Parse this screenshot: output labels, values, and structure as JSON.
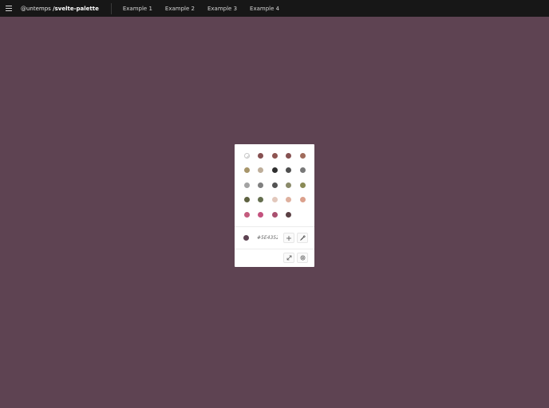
{
  "header": {
    "scope": "@untemps",
    "package": "/svelte-palette",
    "nav": [
      "Example 1",
      "Example 2",
      "Example 3",
      "Example 4"
    ]
  },
  "colors": {
    "background": "#5E4352",
    "topbar": "#171717"
  },
  "palette": {
    "swatches": [
      [
        "transparent",
        "#865051",
        "#8E5451",
        "#865151",
        "#A06B5B"
      ],
      [
        "#A7956A",
        "#BEAE9A",
        "#2F2F2F",
        "#4F4F4F",
        "#787878"
      ],
      [
        "#A3A3A3",
        "#7F7F7F",
        "#535353",
        "#8A8A6A",
        "#8A8A55"
      ],
      [
        "#5E6140",
        "#656F4F",
        "#E2C8BC",
        "#DEB09E",
        "#DBA08C"
      ],
      [
        "#C45C7E",
        "#C4527E",
        "#A9506F",
        "#5B4044"
      ]
    ],
    "current_color": "#5E4352",
    "hex_value": "#5E4352",
    "icons": {
      "add": "plus-icon",
      "eyedropper": "eyedropper-icon",
      "transparent": "transparent-icon",
      "expand": "expand-icon",
      "settings": "gear-icon"
    }
  }
}
